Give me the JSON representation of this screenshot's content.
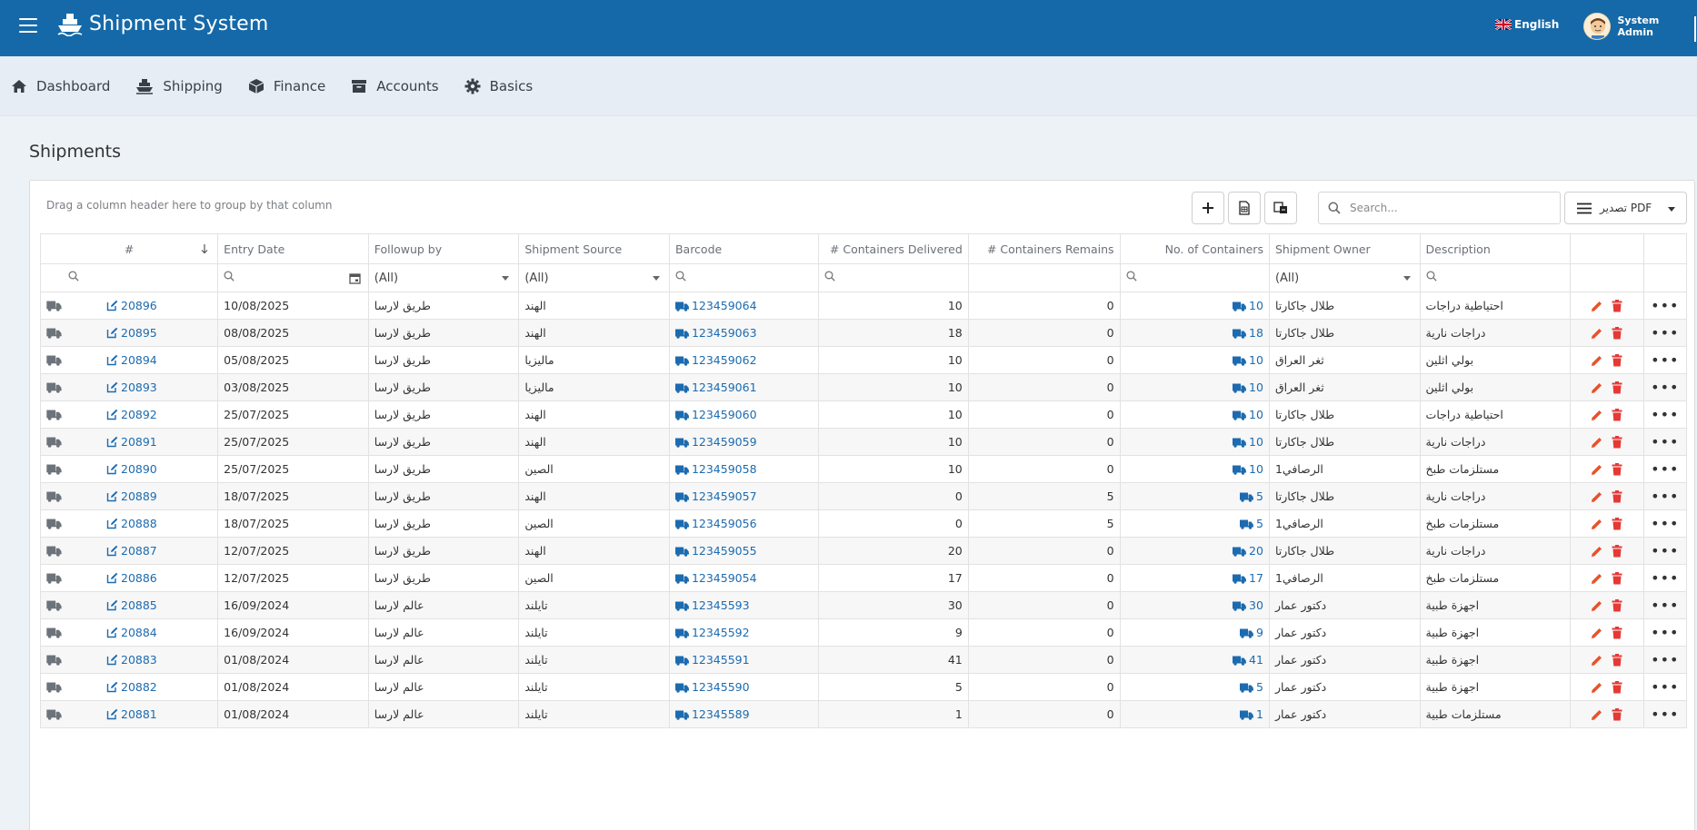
{
  "app": {
    "title": "Shipment System"
  },
  "header": {
    "language": "English",
    "user": "System Admin"
  },
  "nav": [
    {
      "label": "Dashboard",
      "icon": "home-icon"
    },
    {
      "label": "Shipping",
      "icon": "ship-icon"
    },
    {
      "label": "Finance",
      "icon": "box-icon"
    },
    {
      "label": "Accounts",
      "icon": "archive-icon"
    },
    {
      "label": "Basics",
      "icon": "gear-icon"
    }
  ],
  "page": {
    "title": "Shipments"
  },
  "toolbar": {
    "group_hint": "Drag a column header here to group by that column",
    "search_placeholder": "Search...",
    "export_label": "تصدير PDF"
  },
  "columns": [
    "#",
    "Entry Date",
    "Followup by",
    "Shipment Source",
    "Barcode",
    "# Containers Delivered",
    "# Containers Remains",
    "No. of Containers",
    "Shipment Owner",
    "Description"
  ],
  "filters": {
    "followup": "(All)",
    "source": "(All)",
    "owner": "(All)"
  },
  "rows": [
    {
      "id": "20896",
      "date": "10/08/2025",
      "followup": "طريق لارسا",
      "source": "الهند",
      "barcode": "123459064",
      "delivered": "10",
      "remains": "0",
      "containers": "10",
      "owner": "طلال جاكارتا",
      "description": "احتياطية دراجات"
    },
    {
      "id": "20895",
      "date": "08/08/2025",
      "followup": "طريق لارسا",
      "source": "الهند",
      "barcode": "123459063",
      "delivered": "18",
      "remains": "0",
      "containers": "18",
      "owner": "طلال جاكارتا",
      "description": "دراجات نارية"
    },
    {
      "id": "20894",
      "date": "05/08/2025",
      "followup": "طريق لارسا",
      "source": "ماليزيا",
      "barcode": "123459062",
      "delivered": "10",
      "remains": "0",
      "containers": "10",
      "owner": "ثغر العراق",
      "description": "بولي اثلين"
    },
    {
      "id": "20893",
      "date": "03/08/2025",
      "followup": "طريق لارسا",
      "source": "ماليزيا",
      "barcode": "123459061",
      "delivered": "10",
      "remains": "0",
      "containers": "10",
      "owner": "ثغر العراق",
      "description": "بولي اثلين"
    },
    {
      "id": "20892",
      "date": "25/07/2025",
      "followup": "طريق لارسا",
      "source": "الهند",
      "barcode": "123459060",
      "delivered": "10",
      "remains": "0",
      "containers": "10",
      "owner": "طلال جاكارتا",
      "description": "احتياطية دراجات"
    },
    {
      "id": "20891",
      "date": "25/07/2025",
      "followup": "طريق لارسا",
      "source": "الهند",
      "barcode": "123459059",
      "delivered": "10",
      "remains": "0",
      "containers": "10",
      "owner": "طلال جاكارتا",
      "description": "دراجات نارية"
    },
    {
      "id": "20890",
      "date": "25/07/2025",
      "followup": "طريق لارسا",
      "source": "الصين",
      "barcode": "123459058",
      "delivered": "10",
      "remains": "0",
      "containers": "10",
      "owner": "الرصافي1",
      "description": "مستلزمات طبخ"
    },
    {
      "id": "20889",
      "date": "18/07/2025",
      "followup": "طريق لارسا",
      "source": "الهند",
      "barcode": "123459057",
      "delivered": "0",
      "remains": "5",
      "containers": "5",
      "owner": "طلال جاكارتا",
      "description": "دراجات نارية"
    },
    {
      "id": "20888",
      "date": "18/07/2025",
      "followup": "طريق لارسا",
      "source": "الصين",
      "barcode": "123459056",
      "delivered": "0",
      "remains": "5",
      "containers": "5",
      "owner": "الرصافي1",
      "description": "مستلزمات طبخ"
    },
    {
      "id": "20887",
      "date": "12/07/2025",
      "followup": "طريق لارسا",
      "source": "الهند",
      "barcode": "123459055",
      "delivered": "20",
      "remains": "0",
      "containers": "20",
      "owner": "طلال جاكارتا",
      "description": "دراجات نارية"
    },
    {
      "id": "20886",
      "date": "12/07/2025",
      "followup": "طريق لارسا",
      "source": "الصين",
      "barcode": "123459054",
      "delivered": "17",
      "remains": "0",
      "containers": "17",
      "owner": "الرصافي1",
      "description": "مستلزمات طبخ"
    },
    {
      "id": "20885",
      "date": "16/09/2024",
      "followup": "عالم لارسا",
      "source": "تايلند",
      "barcode": "12345593",
      "delivered": "30",
      "remains": "0",
      "containers": "30",
      "owner": "دكتور عمار",
      "description": "اجهزة طبية"
    },
    {
      "id": "20884",
      "date": "16/09/2024",
      "followup": "عالم لارسا",
      "source": "تايلند",
      "barcode": "12345592",
      "delivered": "9",
      "remains": "0",
      "containers": "9",
      "owner": "دكتور عمار",
      "description": "اجهزة طبية"
    },
    {
      "id": "20883",
      "date": "01/08/2024",
      "followup": "عالم لارسا",
      "source": "تايلند",
      "barcode": "12345591",
      "delivered": "41",
      "remains": "0",
      "containers": "41",
      "owner": "دكتور عمار",
      "description": "اجهزة طبية"
    },
    {
      "id": "20882",
      "date": "01/08/2024",
      "followup": "عالم لارسا",
      "source": "تايلند",
      "barcode": "12345590",
      "delivered": "5",
      "remains": "0",
      "containers": "5",
      "owner": "دكتور عمار",
      "description": "اجهزة طبية"
    },
    {
      "id": "20881",
      "date": "01/08/2024",
      "followup": "عالم لارسا",
      "source": "تايلند",
      "barcode": "12345589",
      "delivered": "1",
      "remains": "0",
      "containers": "1",
      "owner": "دكتور عمار",
      "description": "مستلزمات طبية"
    }
  ],
  "colors": {
    "topbar": "#1569a8",
    "link": "#1c6bb0",
    "edit": "#e8522a",
    "delete": "#e53935"
  }
}
